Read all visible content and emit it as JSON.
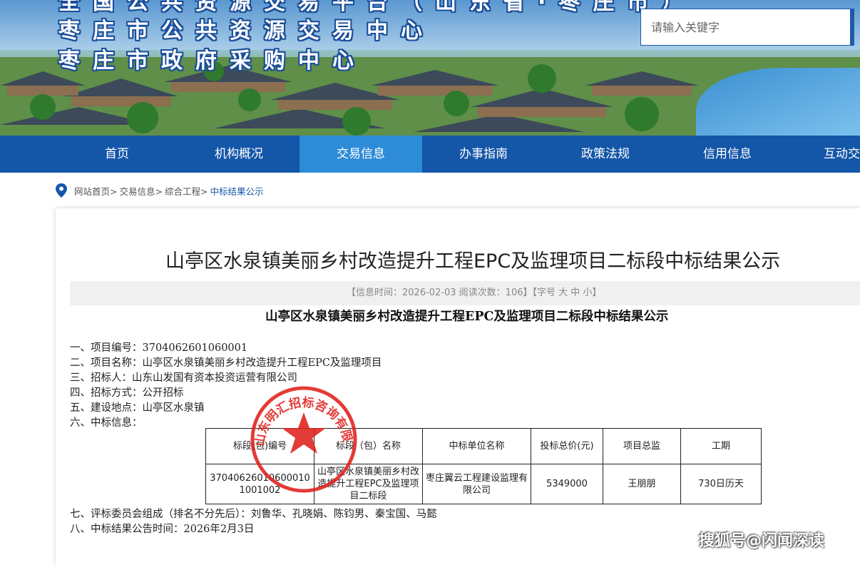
{
  "banner": {
    "title_line1": "全国公共资源交易平台（山东省·枣庄市）",
    "title_line2": "枣庄市公共资源交易中心",
    "title_line3": "枣庄市政府采购中心"
  },
  "search": {
    "placeholder": "请输入关键字"
  },
  "nav": {
    "items": [
      "首页",
      "机构概况",
      "交易信息",
      "办事指南",
      "政策法规",
      "信用信息",
      "互动交流"
    ],
    "active_index": 2,
    "bg_color": "#1456a8",
    "active_color": "#2e8bd8"
  },
  "breadcrumb": {
    "items": [
      "网站首页>",
      "交易信息>",
      "综合工程>"
    ],
    "current": "中标结果公示"
  },
  "article": {
    "title": "山亭区水泉镇美丽乡村改造提升工程EPC及监理项目二标段中标结果公示",
    "meta": "【信息时间：2026-02-03  阅读次数：106】【字号 大 中 小】",
    "subtitle": "山亭区水泉镇美丽乡村改造提升工程EPC及监理项目二标段中标结果公示",
    "lines": [
      "一、项目编号：3704062601060001",
      "二、项目名称：山亭区水泉镇美丽乡村改造提升工程EPC及监理项目",
      "三、招标人：山东山发国有资本投资运营有限公司",
      "四、招标方式：公开招标",
      "五、建设地点：山亭区水泉镇",
      "六、中标信息："
    ],
    "after_lines": [
      "七、评标委员会组成（排名不分先后）：刘鲁华、孔晓娟、陈钧男、秦宝国、马懿",
      "八、中标结果公告时间：2026年2月3日"
    ]
  },
  "table": {
    "headers": [
      "标段(包)编号",
      "标段（包）名称",
      "中标单位名称",
      "投标总价(元)",
      "项目总监",
      "工期"
    ],
    "row": {
      "code": "370406260106000101001002",
      "name": "山亭区水泉镇美丽乡村改造提升工程EPC及监理项目二标段",
      "winner": "枣庄翼云工程建设监理有限公司",
      "price": "5349000",
      "director": "王朋朋",
      "period": "730日历天"
    }
  },
  "stamp": {
    "text": "山东明汇招标咨询有限公司",
    "color": "#e0201c"
  },
  "watermark": "搜狐号@闪闻深读"
}
